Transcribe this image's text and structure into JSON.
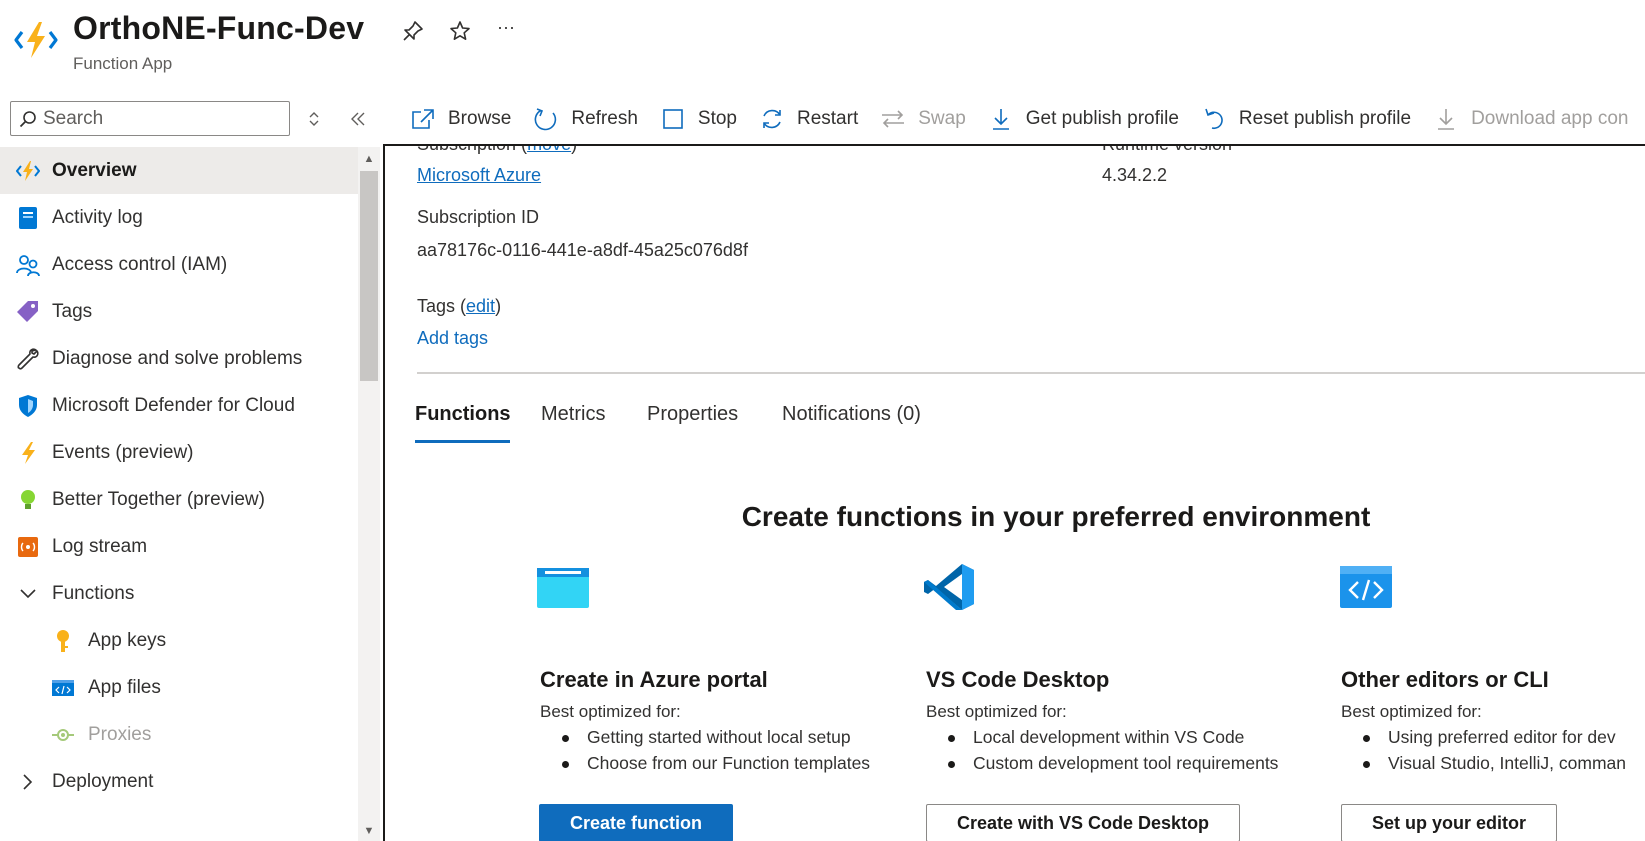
{
  "app": {
    "title": "OrthoNE-Func-Dev",
    "subtitle": "Function App",
    "header_icons": [
      "pin-icon",
      "star-icon",
      "more-icon"
    ],
    "more_label": "···"
  },
  "search": {
    "placeholder": "Search"
  },
  "sidebar": {
    "items": [
      {
        "label": "Overview",
        "icon": "function-app-icon"
      },
      {
        "label": "Activity log",
        "icon": "activity-log-icon"
      },
      {
        "label": "Access control (IAM)",
        "icon": "people-icon"
      },
      {
        "label": "Tags",
        "icon": "tag-icon"
      },
      {
        "label": "Diagnose and solve problems",
        "icon": "wrench-icon"
      },
      {
        "label": "Microsoft Defender for Cloud",
        "icon": "shield-icon"
      },
      {
        "label": "Events (preview)",
        "icon": "lightning-icon"
      },
      {
        "label": "Better Together (preview)",
        "icon": "lightbulb-icon"
      },
      {
        "label": "Log stream",
        "icon": "log-stream-icon"
      },
      {
        "label": "Functions",
        "icon": "chevron-down-icon"
      },
      {
        "label": "App keys",
        "icon": "key-icon"
      },
      {
        "label": "App files",
        "icon": "code-file-icon"
      },
      {
        "label": "Proxies",
        "icon": "proxy-icon"
      },
      {
        "label": "Deployment",
        "icon": "chevron-right-icon"
      }
    ]
  },
  "toolbar": {
    "browse": "Browse",
    "refresh": "Refresh",
    "stop": "Stop",
    "restart": "Restart",
    "swap": "Swap",
    "get_publish_profile": "Get publish profile",
    "reset_publish_profile": "Reset publish profile",
    "download_app_content": "Download app con"
  },
  "essentials": {
    "subscription_label": "Subscription (",
    "subscription_move": "move",
    "subscription_label_end": ")",
    "subscription_value": "Microsoft Azure",
    "runtime_label": "Runtime version",
    "runtime_value": "4.34.2.2",
    "subscription_id_label": "Subscription ID",
    "subscription_id_value": "aa78176c-0116-441e-a8df-45a25c076d8f",
    "tags_label": "Tags (",
    "tags_edit": "edit",
    "tags_label_end": ")",
    "add_tags": "Add tags"
  },
  "tabs": [
    "Functions",
    "Metrics",
    "Properties",
    "Notifications (0)"
  ],
  "section": {
    "title": "Create functions in your preferred environment",
    "cards": [
      {
        "title": "Create in Azure portal",
        "subtitle": "Best optimized for:",
        "bullets": [
          "Getting started without local setup",
          "Choose from our Function templates"
        ],
        "button": "Create function"
      },
      {
        "title": "VS Code Desktop",
        "subtitle": "Best optimized for:",
        "bullets": [
          "Local development within VS Code",
          "Custom development tool requirements"
        ],
        "button": "Create with VS Code Desktop"
      },
      {
        "title": "Other editors or CLI",
        "subtitle": "Best optimized for:",
        "bullets": [
          "Using preferred editor for dev",
          "Visual Studio, IntelliJ, comman"
        ],
        "button": "Set up your editor"
      }
    ]
  },
  "colors": {
    "accent": "#0f6cbd",
    "active_nav": "#edebe9",
    "text": "#323130",
    "disabled": "#a19f9d"
  }
}
